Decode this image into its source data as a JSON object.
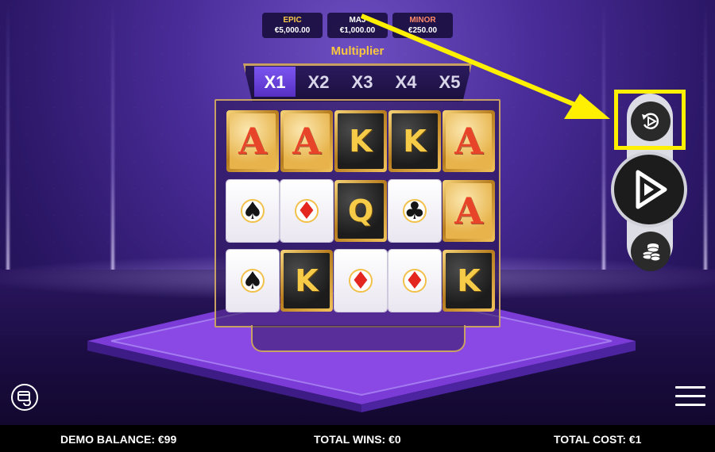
{
  "jackpots": [
    {
      "name": "EPIC",
      "value": "€5,000.00"
    },
    {
      "name": "MAJ",
      "value": "€1,000.00"
    },
    {
      "name": "MINOR",
      "value": "€250.00"
    }
  ],
  "multiplier": {
    "title": "Multiplier",
    "options": [
      "X1",
      "X2",
      "X3",
      "X4",
      "X5"
    ],
    "active": "X1"
  },
  "grid": [
    [
      "A",
      "A",
      "K",
      "K",
      "A"
    ],
    [
      "spade",
      "diamond",
      "Q",
      "club",
      "A"
    ],
    [
      "spade",
      "K",
      "diamond",
      "diamond",
      "K"
    ]
  ],
  "controls": {
    "autoplay_icon": "autoplay-icon",
    "spin_icon": "spin-play-icon",
    "bet_icon": "coin-stack-icon"
  },
  "highlight_color": "#ffef00",
  "status": {
    "balance": "DEMO BALANCE: €99",
    "wins": "TOTAL WINS: €0",
    "cost": "TOTAL COST: €1"
  }
}
